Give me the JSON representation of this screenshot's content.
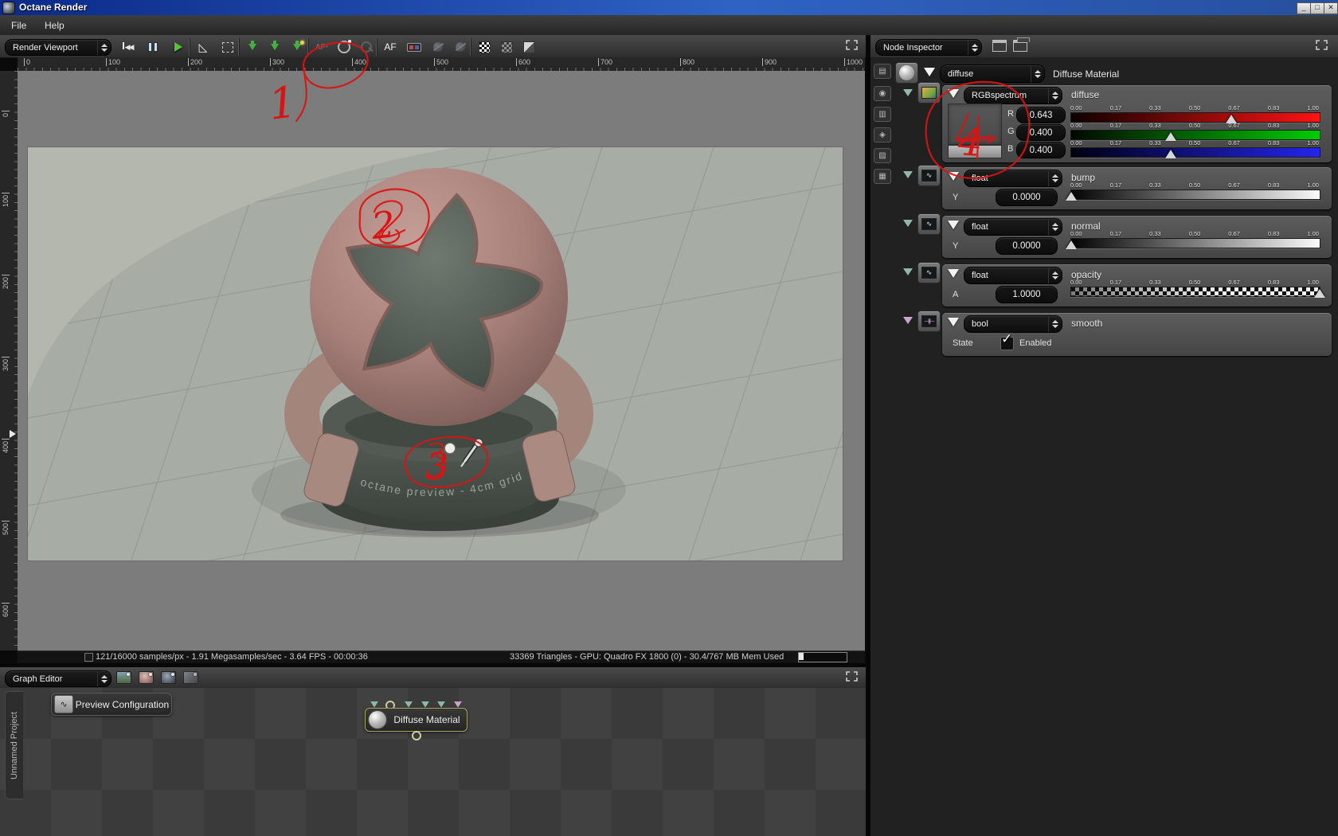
{
  "window": {
    "title": "Octane Render"
  },
  "menu": {
    "file": "File",
    "help": "Help"
  },
  "viewport": {
    "panel_select": "Render Viewport",
    "toolbar": {
      "af_small": "AF¹",
      "af": "AF"
    },
    "toolbar_icons": [
      "restart-icon",
      "pause-icon",
      "play-icon",
      "imager-icon",
      "fit-region-icon",
      "save-image-icon",
      "save-render-state-icon",
      "save-lighting-icon",
      "autofocus-pick-icon",
      "whitebalance-pick-icon",
      "material-pick-icon",
      "autofocus-icon",
      "stereo-glasses-icon",
      "lens-a-icon",
      "lens-b-icon",
      "alpha-checker-bright-icon",
      "alpha-checker-dim-icon",
      "background-half-icon"
    ],
    "ruler_top": [
      "0",
      "100",
      "200",
      "300",
      "400",
      "500",
      "600",
      "700",
      "800",
      "900",
      "1000"
    ],
    "ruler_left": [
      "0",
      "100",
      "200",
      "300",
      "400",
      "500",
      "600"
    ],
    "render_caption": "octane preview - 4cm grid",
    "status_left": "121/16000 samples/px - 1.91 Megasamples/sec - 3.64 FPS - 00:00:36",
    "status_right": "33369 Triangles - GPU: Quadro FX 1800 (0) - 30.4/767 MB Mem Used"
  },
  "inspector": {
    "panel_select": "Node Inspector",
    "root_combo": "diffuse",
    "root_label": "Diffuse Material",
    "ticks": [
      "0.00",
      "0.17",
      "0.33",
      "0.50",
      "0.67",
      "0.83",
      "1.00"
    ],
    "rgb": {
      "combo": "RGBspectrum",
      "label": "diffuse",
      "swatch_color": "#b98682",
      "r": {
        "ch": "R",
        "value": "0.643",
        "pos": 64.3
      },
      "g": {
        "ch": "G",
        "value": "0.400",
        "pos": 40
      },
      "b": {
        "ch": "B",
        "value": "0.400",
        "pos": 40
      }
    },
    "bump": {
      "combo": "float",
      "label": "bump",
      "ch": "Y",
      "value": "0.0000",
      "pos": 0
    },
    "normal": {
      "combo": "float",
      "label": "normal",
      "ch": "Y",
      "value": "0.0000",
      "pos": 0
    },
    "opacity": {
      "combo": "float",
      "label": "opacity",
      "ch": "A",
      "value": "1.0000",
      "pos": 100
    },
    "smooth": {
      "combo": "bool",
      "label": "smooth",
      "state": "State",
      "enabled": "Enabled",
      "check_glyph": "✓"
    }
  },
  "graph": {
    "panel_select": "Graph Editor",
    "project_tab": "Unnamed Project",
    "preview_node": "Preview Configuration",
    "material_node": "Diffuse Material"
  },
  "annotations": {
    "n1": "1",
    "n2": "2",
    "n3": "3",
    "n4": "4"
  }
}
